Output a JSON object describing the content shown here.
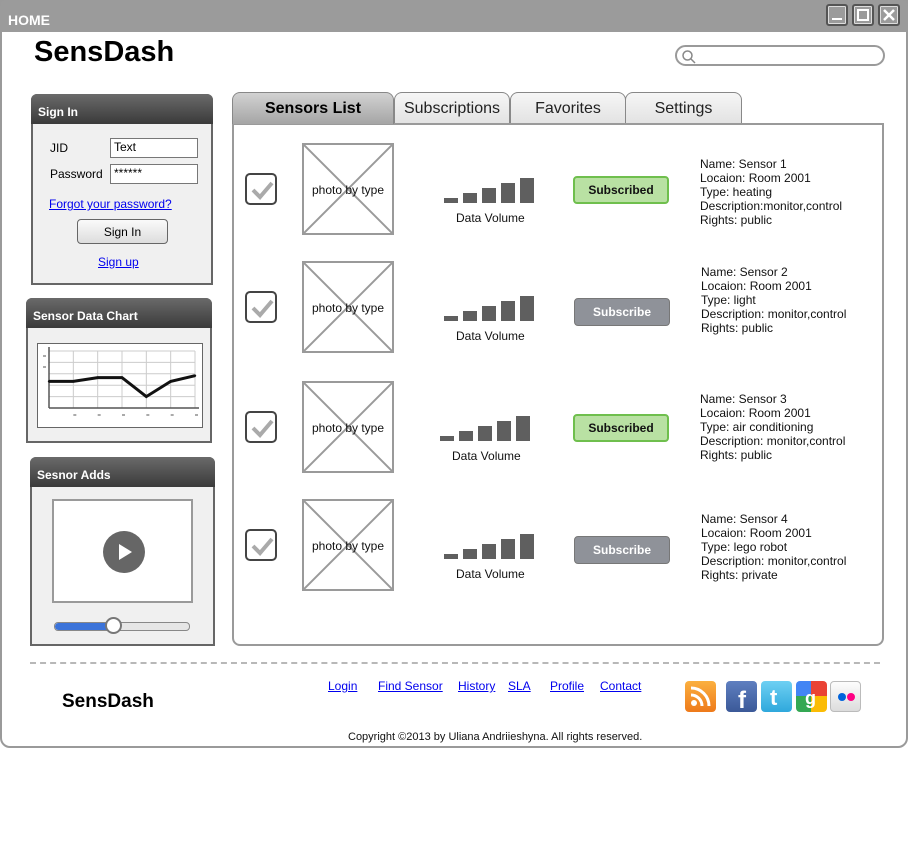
{
  "window": {
    "title": "HOME",
    "controls": [
      "minimize-icon",
      "maximize-icon",
      "close-icon"
    ]
  },
  "brand": "SensDash",
  "search": {
    "placeholder": "",
    "icon": "search-icon"
  },
  "signin": {
    "title": "Sign In",
    "jid_label": "JID",
    "jid_value": "Text",
    "password_label": "Password",
    "password_value": "******",
    "forgot": "Forgot your password?",
    "button": "Sign In",
    "signup": "Sign up"
  },
  "chart_panel": {
    "title": "Sensor Data Chart"
  },
  "chart_data": {
    "type": "line",
    "title": "",
    "xlabel": "",
    "ylabel": "",
    "x": [
      0,
      1,
      2,
      3,
      4,
      5,
      6
    ],
    "values": [
      7,
      7,
      8,
      8,
      3,
      7,
      8.5
    ],
    "ylim": [
      0,
      15
    ],
    "grid": true
  },
  "adds_panel": {
    "title": "Sesnor Adds",
    "video_icon": "play-icon",
    "progress": 0.44
  },
  "tabs": [
    "Sensors List",
    "Subscriptions",
    "Favorites",
    "Settings"
  ],
  "active_tab": "Sensors List",
  "sensors": [
    {
      "photo": "photo by type",
      "volume_label": "Data Volume",
      "button": "Subscribed",
      "subscribed": true,
      "lines": [
        "Name: Sensor 1",
        "Locaion: Room 2001",
        "Type: heating",
        "Description:monitor,control",
        "Rights: public"
      ]
    },
    {
      "photo": "photo by type",
      "volume_label": "Data Volume",
      "button": "Subscribe",
      "subscribed": false,
      "lines": [
        "Name: Sensor 2",
        "Locaion: Room 2001",
        "Type: light",
        "Description: monitor,control",
        "Rights: public"
      ]
    },
    {
      "photo": "photo by type",
      "volume_label": "Data Volume",
      "button": "Subscribed",
      "subscribed": true,
      "lines": [
        "Name: Sensor 3",
        "Locaion: Room 2001",
        "Type: air conditioning",
        "Description: monitor,control",
        "Rights: public"
      ]
    },
    {
      "photo": "photo by type",
      "volume_label": "Data Volume",
      "button": "Subscribe",
      "subscribed": false,
      "lines": [
        "Name: Sensor 4",
        "Locaion: Room 2001",
        "Type: lego robot",
        "Description: monitor,control",
        "Rights: private"
      ]
    }
  ],
  "footer": {
    "brand": "SensDash",
    "links": [
      "Login",
      "Find Sensor",
      "History",
      "SLA",
      "Profile",
      "Contact"
    ],
    "social": [
      "rss-icon",
      "facebook-icon",
      "twitter-icon",
      "google-icon",
      "flickr-icon"
    ],
    "copyright": "Copyright ©2013 by Uliana Andriieshyna. All rights reserved."
  },
  "colors": {
    "accent_green": "#b9e1a3",
    "accent_grey": "#8f9299",
    "titlebar": "#9b9b9b"
  }
}
